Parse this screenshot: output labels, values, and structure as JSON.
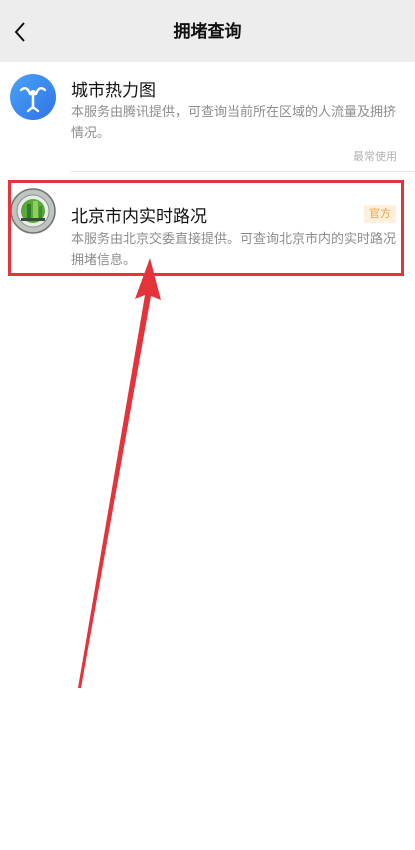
{
  "header": {
    "title": "拥堵查询"
  },
  "items": [
    {
      "title": "城市热力图",
      "description": "本服务由腾讯提供，可查询当前所在区域的人流量及拥挤情况。",
      "usage_tag": "最常使用",
      "icon": "heatmap-person-icon"
    },
    {
      "title": "北京市内实时路况",
      "description": "本服务由北京交委直接提供。可查询北京市内的实时路况拥堵信息。",
      "badge": "官方",
      "icon": "beijing-transport-logo"
    }
  ],
  "colors": {
    "header_bg": "#ededed",
    "highlight": "#e5333b",
    "badge_bg": "#fdf1de",
    "badge_text": "#e8a33d",
    "heat_icon": "#3b8cf0"
  }
}
